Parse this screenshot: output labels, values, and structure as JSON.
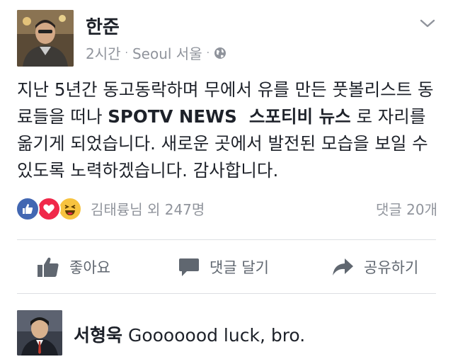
{
  "post": {
    "author": "한준",
    "time": "2시간",
    "separator": "·",
    "location": "Seoul 서울",
    "privacy_icon": "globe-icon",
    "text_before": "지난 5년간 동고동락하며 무에서 유를 만든 풋볼리스트 동료들을 떠나 ",
    "text_bold": "SPOTV NEWS  스포티비 뉴스",
    "text_after": " 로 자리를 옮기게 되었습니다. 새로운 곳에서 발전된 모습을 보일 수 있도록 노력하겠습니다. 감사합니다."
  },
  "reactions": {
    "icons": [
      "like-icon",
      "love-icon",
      "haha-icon"
    ],
    "summary": "김태륭님 외 247명",
    "comment_count": "댓글 20개"
  },
  "actions": {
    "like": "좋아요",
    "comment": "댓글 달기",
    "share": "공유하기"
  },
  "comment": {
    "author": "서형욱",
    "text": "Gooooood luck, bro."
  },
  "colors": {
    "like_blue": "#4267b2",
    "love_red": "#f0284a",
    "haha_yellow": "#f7c33f",
    "meta_gray": "#90949c"
  }
}
